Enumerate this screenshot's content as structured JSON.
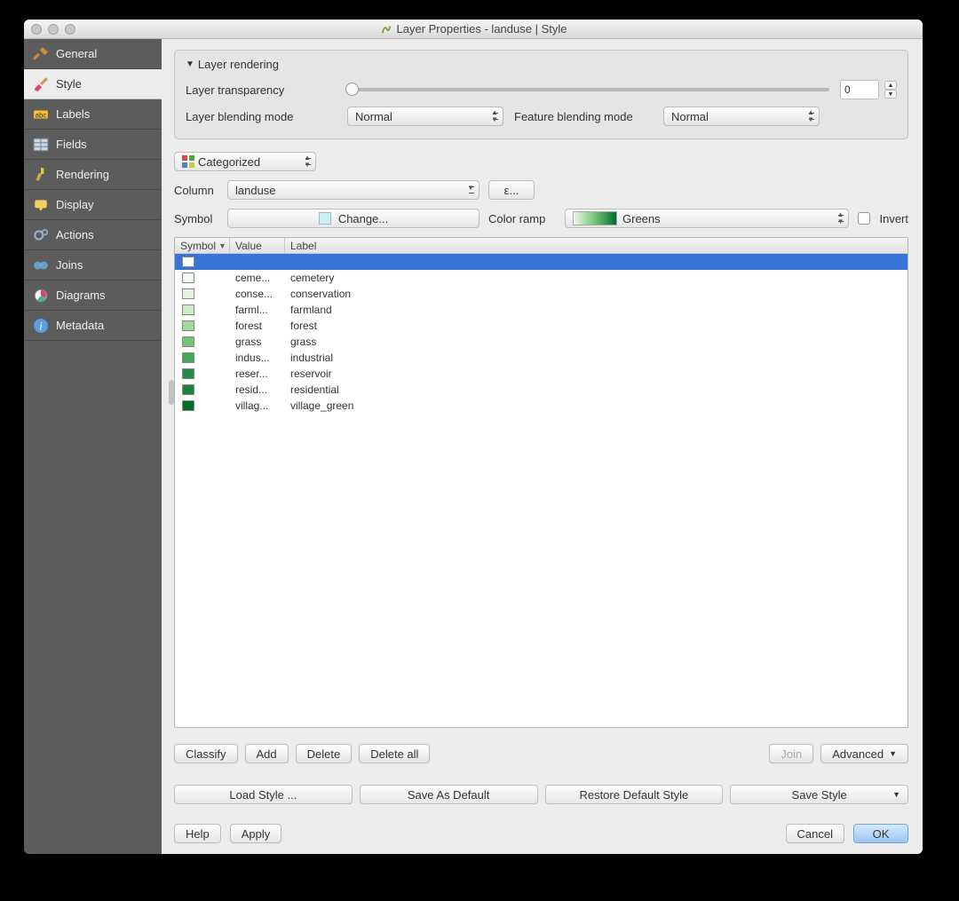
{
  "window": {
    "title": "Layer Properties - landuse | Style"
  },
  "sidebar": {
    "items": [
      {
        "label": "General"
      },
      {
        "label": "Style"
      },
      {
        "label": "Labels"
      },
      {
        "label": "Fields"
      },
      {
        "label": "Rendering"
      },
      {
        "label": "Display"
      },
      {
        "label": "Actions"
      },
      {
        "label": "Joins"
      },
      {
        "label": "Diagrams"
      },
      {
        "label": "Metadata"
      }
    ],
    "active_index": 1
  },
  "rendering_group": {
    "title": "Layer rendering",
    "transparency_label": "Layer transparency",
    "transparency_value": "0",
    "layer_blend_label": "Layer blending mode",
    "layer_blend_value": "Normal",
    "feature_blend_label": "Feature blending mode",
    "feature_blend_value": "Normal"
  },
  "renderer_type": "Categorized",
  "column": {
    "label": "Column",
    "value": "landuse",
    "expr_btn": "ε..."
  },
  "symbol": {
    "label": "Symbol",
    "change": "Change..."
  },
  "color_ramp": {
    "label": "Color ramp",
    "value": "Greens",
    "invert_label": "Invert"
  },
  "table": {
    "headers": {
      "symbol": "Symbol",
      "value": "Value",
      "label": "Label"
    },
    "rows": [
      {
        "color": "#ffffff",
        "value": "",
        "label": "",
        "selected": true
      },
      {
        "color": "#f2faef",
        "value": "ceme...",
        "label": "cemetery"
      },
      {
        "color": "#e5f5e0",
        "value": "conse...",
        "label": "conservation"
      },
      {
        "color": "#cdebc6",
        "value": "farml...",
        "label": "farmland"
      },
      {
        "color": "#a1d99b",
        "value": "forest",
        "label": "forest"
      },
      {
        "color": "#74c476",
        "value": "grass",
        "label": "grass"
      },
      {
        "color": "#41ab5d",
        "value": "indus...",
        "label": "industrial"
      },
      {
        "color": "#238b45",
        "value": "reser...",
        "label": "reservoir"
      },
      {
        "color": "#1a843f",
        "value": "resid...",
        "label": "residential"
      },
      {
        "color": "#006d2c",
        "value": "villag...",
        "label": "village_green"
      }
    ]
  },
  "buttons": {
    "classify": "Classify",
    "add": "Add",
    "delete": "Delete",
    "delete_all": "Delete all",
    "join": "Join",
    "advanced": "Advanced"
  },
  "style_buttons": {
    "load": "Load Style ...",
    "save_default": "Save As Default",
    "restore": "Restore Default Style",
    "save": "Save Style"
  },
  "footer_buttons": {
    "help": "Help",
    "apply": "Apply",
    "cancel": "Cancel",
    "ok": "OK"
  }
}
